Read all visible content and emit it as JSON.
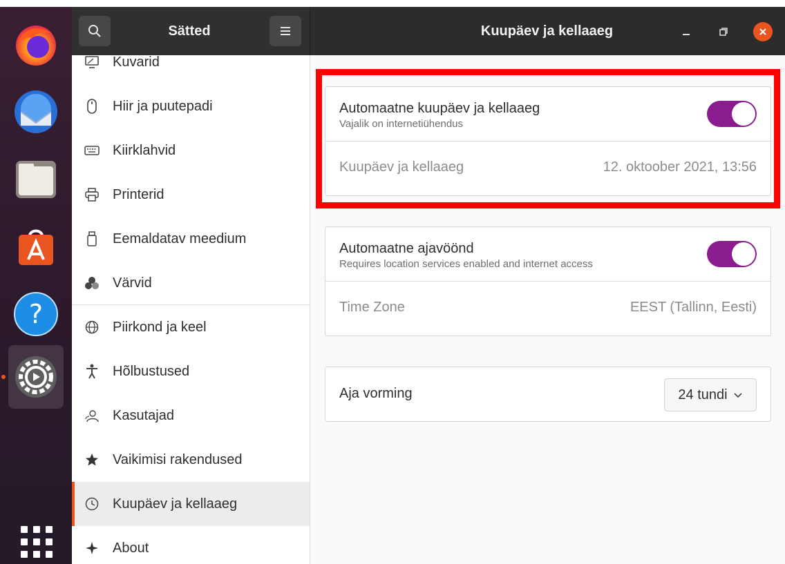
{
  "sidebar": {
    "title": "Sätted",
    "items": [
      {
        "label": "Kuvarid",
        "icon": "display-icon"
      },
      {
        "label": "Hiir ja puutepadi",
        "icon": "mouse-icon"
      },
      {
        "label": "Kiirklahvid",
        "icon": "keyboard-icon"
      },
      {
        "label": "Printerid",
        "icon": "printer-icon"
      },
      {
        "label": "Eemaldatav meedium",
        "icon": "removable-media-icon"
      },
      {
        "label": "Värvid",
        "icon": "color-icon"
      },
      {
        "label": "Piirkond ja keel",
        "icon": "globe-icon"
      },
      {
        "label": "Hõlbustused",
        "icon": "accessibility-icon"
      },
      {
        "label": "Kasutajad",
        "icon": "users-icon"
      },
      {
        "label": "Vaikimisi rakendused",
        "icon": "star-icon"
      },
      {
        "label": "Kuupäev ja kellaaeg",
        "icon": "clock-icon",
        "selected": true
      },
      {
        "label": "About",
        "icon": "sparkle-icon"
      }
    ]
  },
  "main": {
    "title": "Kuupäev ja kellaaeg",
    "auto_datetime": {
      "title": "Automaatne kuupäev ja kellaaeg",
      "subtitle": "Vajalik on internetiühendus",
      "enabled": true
    },
    "datetime": {
      "label": "Kuupäev ja kellaaeg",
      "value": "12. oktoober 2021, 13:56"
    },
    "auto_timezone": {
      "title": "Automaatne ajavöönd",
      "subtitle": "Requires location services enabled and internet access",
      "enabled": true
    },
    "timezone": {
      "label": "Time Zone",
      "value": "EEST (Tallinn, Eesti)"
    },
    "time_format": {
      "label": "Aja vorming",
      "value": "24 tundi"
    }
  },
  "colors": {
    "accent": "#e95420",
    "toggle_on": "#8a1c8f",
    "highlight": "#ff0000"
  }
}
